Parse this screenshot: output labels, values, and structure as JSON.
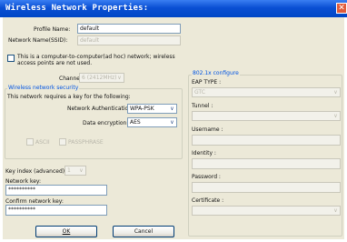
{
  "window": {
    "title": "Wireless Network Properties:",
    "close_glyph": "✕"
  },
  "profile": {
    "label": "Profile Name:",
    "value": "default"
  },
  "ssid": {
    "label": "Network Name(SSID):",
    "value": "default"
  },
  "adhoc": {
    "line1": "This is a computer-to-computer(ad hoc) network; wireless",
    "line2": "access points are not used."
  },
  "channel": {
    "label": "Channel:",
    "value": "6 (2412MHz)"
  },
  "security": {
    "group_label": "Wireless network security",
    "requires_key": "This network requires a key for the following:",
    "auth_label": "Network Authentication:",
    "auth_value": "WPA-PSK",
    "enc_label": "Data encryption:",
    "enc_value": "AES",
    "ascii_label": "ASCII",
    "passphrase_label": "PASSPHRASE",
    "key_index_label": "Key index (advanced):",
    "key_index_value": "1",
    "network_key_label": "Network key:",
    "network_key_value": "**********",
    "confirm_key_label": "Confirm network key:",
    "confirm_key_value": "**********"
  },
  "dot1x": {
    "group_label": "802.1x configure",
    "eap_label": "EAP TYPE :",
    "eap_value": "GTC",
    "tunnel_label": "Tunnel :",
    "username_label": "Username :",
    "identity_label": "Identity :",
    "password_label": "Password :",
    "certificate_label": "Certificate :"
  },
  "buttons": {
    "ok": "OK",
    "cancel": "Cancel"
  }
}
